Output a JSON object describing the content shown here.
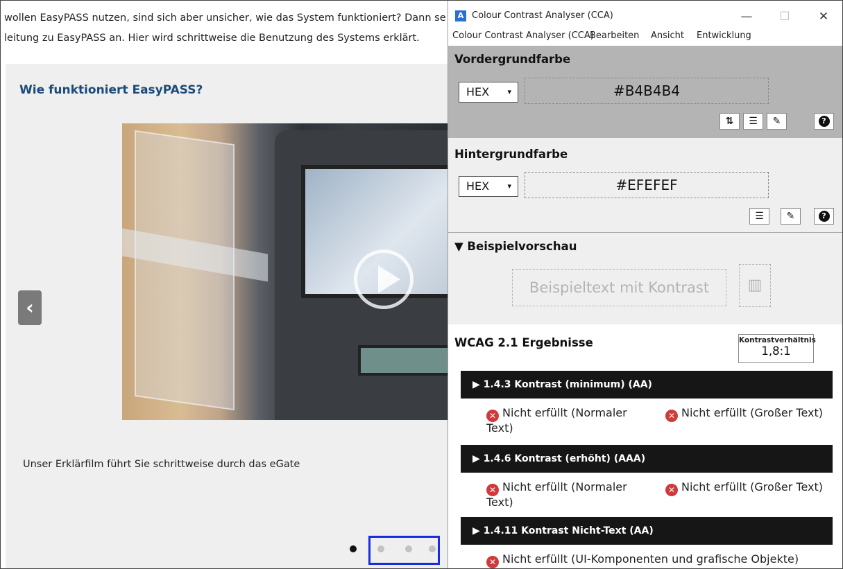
{
  "web": {
    "intro_line1": "wollen EasyPASS nutzen, sind sich aber unsicher, wie das System funktioniert? Dann se",
    "intro_line2": "leitung zu EasyPASS an. Hier wird schrittweise die Benutzung des Systems erklärt.",
    "heading": "Wie funktioniert EasyPASS?",
    "caption": "Unser Erklärfilm führt Sie schrittweise durch das eGate",
    "prev_glyph": "‹",
    "slides": {
      "total": 4,
      "active_index": 0
    }
  },
  "cca": {
    "window_title": "Colour Contrast Analyser (CCA)",
    "window_controls": {
      "minimize": "—",
      "maximize": "☐",
      "close": "✕"
    },
    "menu": [
      "Colour Contrast Analyser (CCA)",
      "Bearbeiten",
      "Ansicht",
      "Entwicklung"
    ],
    "foreground": {
      "label": "Vordergrundfarbe",
      "format": "HEX",
      "value": "#B4B4B4",
      "color": "#b4b4b4",
      "tools": [
        "swap-icon",
        "sliders-icon",
        "eyedropper-icon",
        "help-icon"
      ]
    },
    "background": {
      "label": "Hintergrundfarbe",
      "format": "HEX",
      "value": "#EFEFEF",
      "color": "#efefef",
      "tools": [
        "sliders-icon",
        "eyedropper-icon",
        "help-icon"
      ]
    },
    "preview": {
      "label": "▼ Beispielvorschau",
      "sample_text": "Beispieltext mit Kontrast"
    },
    "wcag": {
      "title": "WCAG 2.1 Ergebnisse",
      "ratio_label": "Kontrastverhältnis",
      "ratio_value": "1,8:1",
      "criteria": [
        {
          "label": "▶ 1.4.3 Kontrast (minimum) (AA)",
          "result_a_line1": "Nicht erfüllt (Normaler",
          "result_a_line2": "Text)",
          "result_b": "Nicht erfüllt (Großer Text)"
        },
        {
          "label": "▶ 1.4.6 Kontrast (erhöht) (AAA)",
          "result_a_line1": "Nicht erfüllt (Normaler",
          "result_a_line2": "Text)",
          "result_b": "Nicht erfüllt (Großer Text)"
        },
        {
          "label": "▶ 1.4.11 Kontrast Nicht-Text (AA)",
          "result_a_line1": "Nicht erfüllt (UI-Komponenten und grafische Objekte)"
        }
      ]
    },
    "status_color_fail": "#d03a3a"
  }
}
